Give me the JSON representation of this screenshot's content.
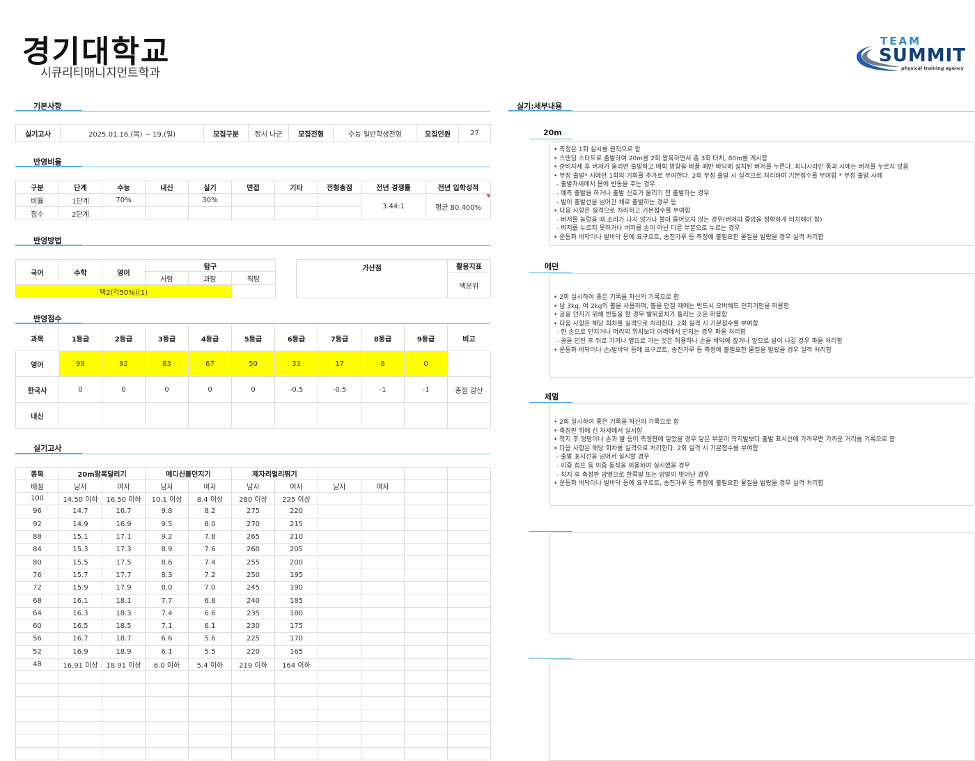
{
  "header": {
    "university": "경기대학교",
    "department": "시큐리티매니지먼트학과",
    "logo_team": "TEAM",
    "logo_summit": "SUMMIT",
    "logo_tagline": "physical training agency"
  },
  "sections": {
    "basic": "기본사항",
    "ratio": "반영비율",
    "method": "반영방법",
    "score": "반영점수",
    "practical": "실기고사",
    "details": "실기:세부내용"
  },
  "basic_info": {
    "exam_label": "실기고사",
    "exam_date": "2025.01.16.(목) ~ 19.(일)",
    "recruit_type_label": "모집구분",
    "recruit_type": "정시 나군",
    "admission_label": "모집전형",
    "admission": "수능 일반학생전형",
    "quota_label": "모집인원",
    "quota": "27"
  },
  "ratio": {
    "headers": [
      "구분",
      "단계",
      "수능",
      "내신",
      "실기",
      "면접",
      "기타",
      "전형총점",
      "전년 경쟁률",
      "전년 입학성적"
    ],
    "rows": [
      [
        "비율",
        "1단계",
        "70%",
        "",
        "30%",
        "",
        "",
        ""
      ],
      [
        "점수",
        "2단계",
        "",
        "",
        "",
        "",
        "",
        ""
      ]
    ],
    "prev_competition": "3.44:1",
    "prev_score": "평균 80.400%"
  },
  "method": {
    "headers": [
      "국어",
      "수학",
      "영어"
    ],
    "inquiry_label": "탐구",
    "inquiry_sub": [
      "사탐",
      "과탐",
      "직탐"
    ],
    "bonus_label": "가산점",
    "index_label": "활용지표",
    "index_value": "백분위",
    "selection": "택2(각50%)(1)"
  },
  "score_table": {
    "headers": [
      "과목",
      "1등급",
      "2등급",
      "3등급",
      "4등급",
      "5등급",
      "6등급",
      "7등급",
      "8등급",
      "9등급",
      "비고"
    ],
    "rows": [
      {
        "subject": "영어",
        "values": [
          "98",
          "92",
          "83",
          "67",
          "50",
          "33",
          "17",
          "8",
          "0"
        ],
        "note": ""
      },
      {
        "subject": "한국사",
        "values": [
          "0",
          "0",
          "0",
          "0",
          "0",
          "-0.5",
          "-0.5",
          "-1",
          "-1"
        ],
        "note": "총점 감산"
      },
      {
        "subject": "내신",
        "values": [
          "",
          "",
          "",
          "",
          "",
          "",
          "",
          "",
          ""
        ],
        "note": ""
      }
    ]
  },
  "practical": {
    "event_label": "종목",
    "events": [
      "20m왕복달리기",
      "메디신볼던지기",
      "제자리멀리뛰기",
      ""
    ],
    "score_label": "배점",
    "genders": [
      "남자",
      "여자",
      "남자",
      "여자",
      "남자",
      "여자",
      "남자",
      "여자"
    ],
    "rows": [
      [
        "100",
        "14.50 이하",
        "16.50 이하",
        "10.1 이상",
        "8.4 이상",
        "280 이상",
        "225 이상"
      ],
      [
        "96",
        "14.7",
        "16.7",
        "9.8",
        "8.2",
        "275",
        "220"
      ],
      [
        "92",
        "14.9",
        "16.9",
        "9.5",
        "8.0",
        "270",
        "215"
      ],
      [
        "88",
        "15.1",
        "17.1",
        "9.2",
        "7.8",
        "265",
        "210"
      ],
      [
        "84",
        "15.3",
        "17.3",
        "8.9",
        "7.6",
        "260",
        "205"
      ],
      [
        "80",
        "15.5",
        "17.5",
        "8.6",
        "7.4",
        "255",
        "200"
      ],
      [
        "76",
        "15.7",
        "17.7",
        "8.3",
        "7.2",
        "250",
        "195"
      ],
      [
        "72",
        "15.9",
        "17.9",
        "8.0",
        "7.0",
        "245",
        "190"
      ],
      [
        "68",
        "16.1",
        "18.1",
        "7.7",
        "6.8",
        "240",
        "185"
      ],
      [
        "64",
        "16.3",
        "18.3",
        "7.4",
        "6.6",
        "235",
        "180"
      ],
      [
        "60",
        "16.5",
        "18.5",
        "7.1",
        "6.1",
        "230",
        "175"
      ],
      [
        "56",
        "16.7",
        "18.7",
        "6.6",
        "5.6",
        "225",
        "170"
      ],
      [
        "52",
        "16.9",
        "18.9",
        "6.1",
        "5.5",
        "220",
        "165"
      ],
      [
        "48",
        "16.91 이상",
        "18.91 이상",
        "6.0 이하",
        "5.4 이하",
        "219 이하",
        "164 이하"
      ]
    ]
  },
  "details": {
    "run": {
      "title": "20m",
      "items": [
        {
          "t": "• 측정은 1회 실시를 원칙으로 함",
          "sub": false
        },
        {
          "t": "• 스탠딩 스타트로 출발하여 20m를 2회 왕복하면서 총 3회 터치, 80m를 계시함",
          "sub": false
        },
        {
          "t": "• 준비자세 후 버저가 울리면 출발하고 매회 방향을 바꿀 때만 바닥에 설치된 버저를 누른다. 피니시라인 통과 시에는 버저를 누르지 않음",
          "sub": false
        },
        {
          "t": "• 부정 출발* 시에만 1회의 기회를 추가로 부여한다. 2회 부정 출발 시 실격으로 처리하며 기본점수를 부여함 * 부정 출발 사례",
          "sub": false
        },
        {
          "t": "- 출발자세에서 몸에 반동을 주는 경우",
          "sub": true
        },
        {
          "t": "- 예측 출발을 하거나 출발 신호가 울리기 전 출발하는 경우",
          "sub": true
        },
        {
          "t": "- 발이 출발선을 넘어간 채로 출발하는 경우 등",
          "sub": true
        },
        {
          "t": "• 다음 사항은 실격으로 처리하고 기본점수를 부여함",
          "sub": false
        },
        {
          "t": "- 버저를 눌렀을 때 소리가 나지 않거나 불이 들어오지 않는 경우(버저의 중앙을 정확하게 터치해야 함)",
          "sub": true
        },
        {
          "t": "- 버저를 누르지 못하거나 버저를 손이 아닌 다른 부분으로 누르는 경우",
          "sub": true
        },
        {
          "t": "• 운동화 바닥이나 발바닥 등에 요구르트, 송진가루 등 측정에 불필요한 물질을 발랐을 경우 실격 처리함",
          "sub": false
        }
      ]
    },
    "medicine": {
      "title": "메던",
      "items": [
        {
          "t": "• 2회 실시하여 좋은 기록을 자신의 기록으로 함",
          "sub": false
        },
        {
          "t": "• 남 3kg, 여 2kg의 볼을 사용하며, 볼을 던질 때에는 반드시 오버헤드 던지기만을 허용함",
          "sub": false
        },
        {
          "t": "• 공을 던지기 위해 반동을 할 경우 발뒤꿈치가 들리는 것은 허용함",
          "sub": false
        },
        {
          "t": "• 다음 사항은 해당 회차를 실격으로 처리한다. 2회 실격 시 기본점수를 부여함",
          "sub": false
        },
        {
          "t": "- 한 손으로 던지거나 머리의 위치보다 아래에서 던지는 경우 파울 처리함",
          "sub": true
        },
        {
          "t": "- 공을 던진 후 뒤로 가거나 옆으로 가는 것은 허용하나 손을 바닥에 짚거나 앞으로 발이 나갈 경우 파울 처리함",
          "sub": true
        },
        {
          "t": "• 운동화 바닥이나 손/발바닥 등에 요구르트, 송진가루 등 측정에 불필요한 물질을 발랐을 경우 실격 처리함",
          "sub": false
        }
      ]
    },
    "jump": {
      "title": "제멀",
      "items": [
        {
          "t": "• 2회 실시하여 좋은 기록을 자신의 기록으로 함",
          "sub": false
        },
        {
          "t": "• 측정판 위에 선 자세에서 실시함",
          "sub": false
        },
        {
          "t": "• 착지 후 엉덩이나 손과 발 등이 측정판에 닿았을 경우 닿은 부분이 착지발보다 출발 표시선에 가까우면 가까운 거리를 기록으로 함",
          "sub": false
        },
        {
          "t": "• 다음 사항은 해당 회차를 실격으로 처리한다. 2회 실격 시 기본점수를 부여함",
          "sub": false
        },
        {
          "t": "- 출발 표시선을 넘어서 실시할 경우",
          "sub": true
        },
        {
          "t": "- 이중 점프 등 이중 동작을 이용하여 실시했을 경우",
          "sub": true
        },
        {
          "t": "- 착지 후 측정판 양옆으로 한쪽발 또는 양발이 벗어난 경우",
          "sub": true
        },
        {
          "t": "• 운동화 바닥이나 발바닥 등에 요구르트, 송진가루 등 측정에 불필요한 물질을 발랐을 경우 실격 처리함",
          "sub": false
        }
      ]
    }
  },
  "colors": {
    "highlight": "#ffff00",
    "section_line": "#5bc0de",
    "logo_blue": "#1f5fa8"
  }
}
